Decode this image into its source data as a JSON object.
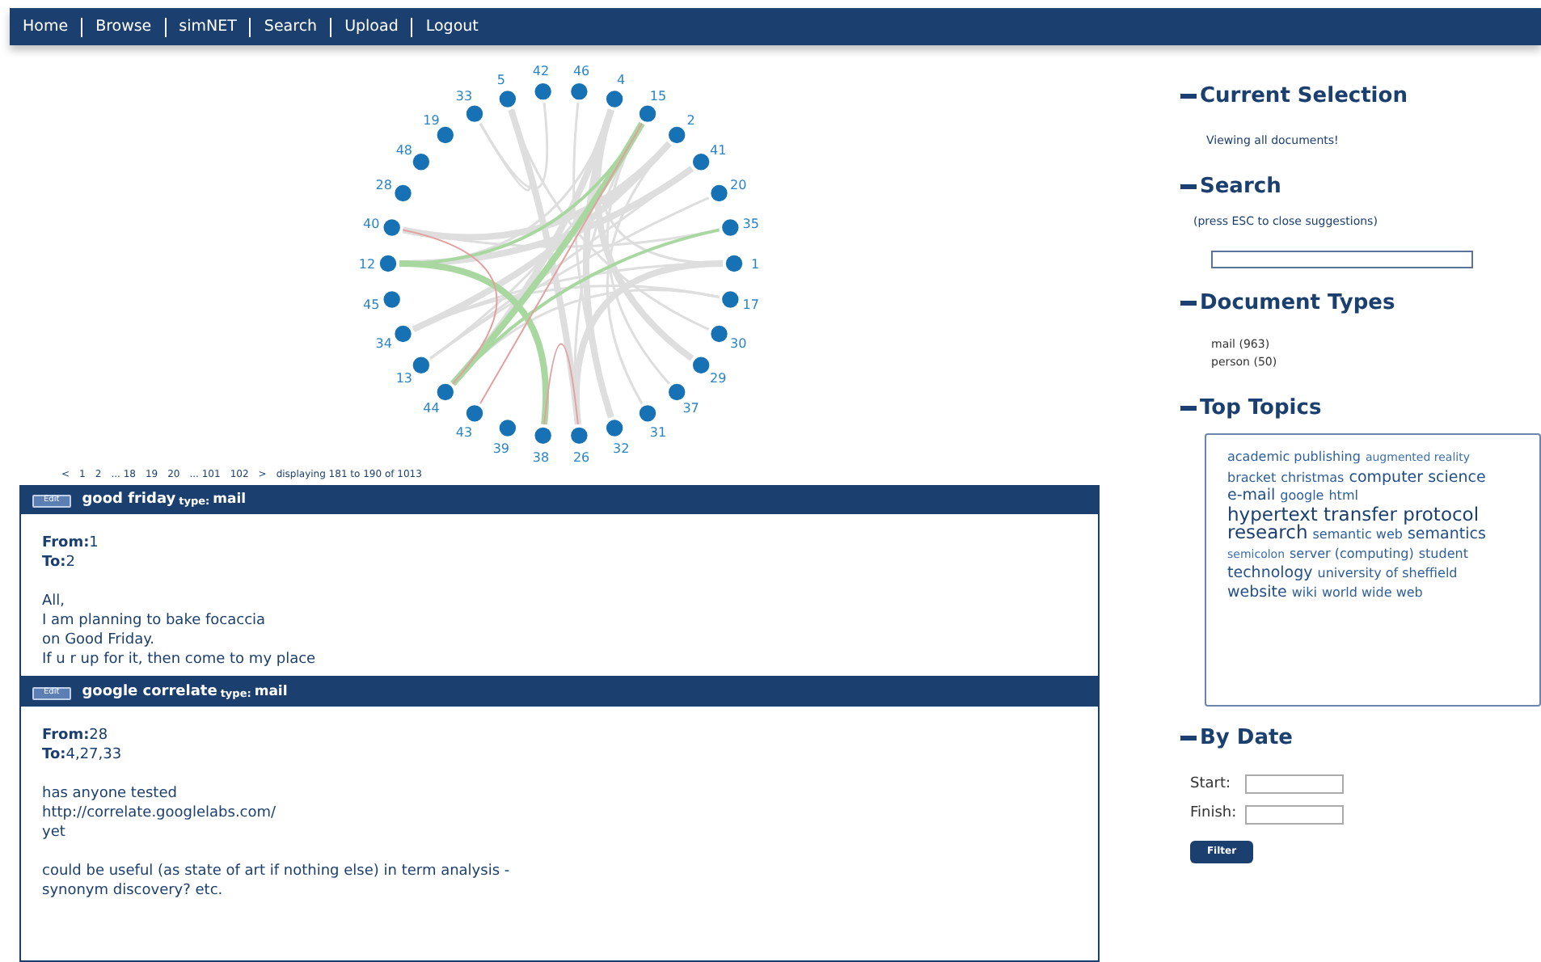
{
  "nav": [
    "Home",
    "Browse",
    "simNET",
    "Search",
    "Upload",
    "Logout"
  ],
  "graph": {
    "right_nodes": [
      "5",
      "42",
      "46",
      "4",
      "15",
      "2",
      "41",
      "20",
      "35",
      "1",
      "17",
      "30",
      "29",
      "37",
      "31",
      "32",
      "26"
    ],
    "left_nodes": [
      "33",
      "19",
      "48",
      "28",
      "40",
      "12",
      "45",
      "34",
      "13",
      "44",
      "43",
      "39",
      "38"
    ]
  },
  "pagination": {
    "links": [
      "<",
      "1",
      "2",
      "... 18",
      "19",
      "20",
      "... 101",
      "102",
      ">"
    ],
    "summary": "displaying 181 to 190 of 1013"
  },
  "documents": [
    {
      "edit": "Edit",
      "title": "good friday",
      "type_label": "type:",
      "type": "mail",
      "from_label": "From:",
      "from": "1",
      "to_label": "To:",
      "to": "2",
      "paragraphs": [
        [
          "All,",
          "I am planning to bake focaccia",
          "on Good Friday.",
          "If u r up for it, then come to my place"
        ]
      ]
    },
    {
      "edit": "Edit",
      "title": "google correlate",
      "type_label": "type:",
      "type": "mail",
      "from_label": "From:",
      "from": "28",
      "to_label": "To:",
      "to": "4,27,33",
      "paragraphs": [
        [
          "has anyone tested",
          "http://correlate.googlelabs.com/",
          "yet"
        ],
        [
          "could be useful (as state of art if nothing else) in term analysis -",
          "synonym discovery? etc."
        ]
      ]
    }
  ],
  "sidebar": {
    "current_selection": {
      "title": "Current Selection",
      "text": "Viewing all documents!"
    },
    "search": {
      "title": "Search",
      "hint": "(press ESC to close suggestions)"
    },
    "document_types": {
      "title": "Document Types",
      "items": [
        "mail (963)",
        "person (50)"
      ]
    },
    "top_topics": {
      "title": "Top Topics",
      "topics": [
        {
          "text": "academic publishing",
          "kind": "medium"
        },
        {
          "text": "augmented reality",
          "kind": "small"
        },
        {
          "text": "bracket",
          "kind": "medium"
        },
        {
          "text": "christmas",
          "kind": "medium"
        },
        {
          "text": "computer science",
          "kind": "large"
        },
        {
          "text": "e-mail",
          "kind": "large"
        },
        {
          "text": "google",
          "kind": "medium"
        },
        {
          "text": "html",
          "kind": "medium"
        },
        {
          "text": "hypertext transfer protocol",
          "kind": "xlarge"
        },
        {
          "text": "research",
          "kind": "xlarge"
        },
        {
          "text": "semantic web",
          "kind": "medium"
        },
        {
          "text": "semantics",
          "kind": "large"
        },
        {
          "text": "semicolon",
          "kind": "small"
        },
        {
          "text": "server (computing)",
          "kind": "medium"
        },
        {
          "text": "student",
          "kind": "medium"
        },
        {
          "text": "technology",
          "kind": "large"
        },
        {
          "text": "university of sheffield",
          "kind": "medium"
        },
        {
          "text": "website",
          "kind": "large"
        },
        {
          "text": "wiki",
          "kind": "medium"
        },
        {
          "text": "world wide web",
          "kind": "medium"
        }
      ]
    },
    "by_date": {
      "title": "By Date",
      "start_label": "Start:",
      "finish_label": "Finish:",
      "button": "Filter"
    }
  }
}
